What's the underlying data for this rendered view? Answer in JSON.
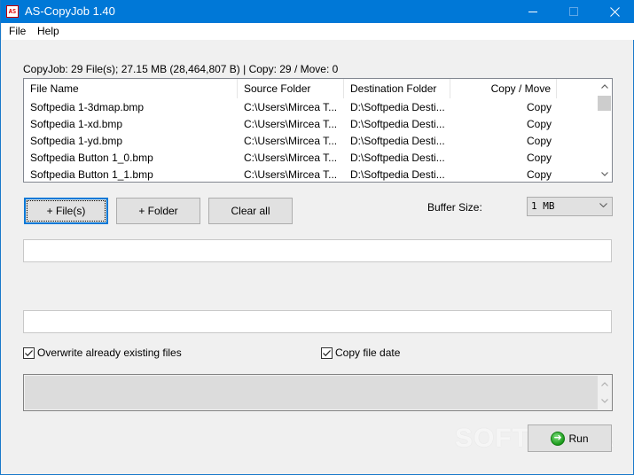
{
  "window": {
    "title": "AS-CopyJob 1.40",
    "icon_text": "AS",
    "controls": {
      "minimize": "minimize-icon",
      "maximize": "maximize-icon",
      "close": "close-icon"
    }
  },
  "menu": {
    "items": [
      {
        "label": "File"
      },
      {
        "label": "Help"
      }
    ]
  },
  "summary": "CopyJob: 29 File(s); 27.15 MB (28,464,807 B) | Copy: 29 / Move: 0",
  "file_list": {
    "columns": [
      "File Name",
      "Source Folder",
      "Destination Folder",
      "Copy / Move"
    ],
    "rows": [
      {
        "name": "Softpedia 1-3dmap.bmp",
        "source": "C:\\Users\\Mircea T...",
        "destination": "D:\\Softpedia Desti...",
        "mode": "Copy"
      },
      {
        "name": "Softpedia 1-xd.bmp",
        "source": "C:\\Users\\Mircea T...",
        "destination": "D:\\Softpedia Desti...",
        "mode": "Copy"
      },
      {
        "name": "Softpedia 1-yd.bmp",
        "source": "C:\\Users\\Mircea T...",
        "destination": "D:\\Softpedia Desti...",
        "mode": "Copy"
      },
      {
        "name": "Softpedia Button 1_0.bmp",
        "source": "C:\\Users\\Mircea T...",
        "destination": "D:\\Softpedia Desti...",
        "mode": "Copy"
      },
      {
        "name": "Softpedia Button 1_1.bmp",
        "source": "C:\\Users\\Mircea T...",
        "destination": "D:\\Softpedia Desti...",
        "mode": "Copy"
      }
    ]
  },
  "buttons": {
    "add_files": "+ File(s)",
    "add_folder": "+ Folder",
    "clear_all": "Clear all",
    "run": "Run"
  },
  "buffer": {
    "label": "Buffer Size:",
    "value": "1 MB"
  },
  "fields": {
    "field1_value": "",
    "field2_value": ""
  },
  "options": {
    "overwrite": {
      "label": "Overwrite already existing files",
      "checked": true
    },
    "copy_date": {
      "label": "Copy file date",
      "checked": true
    }
  },
  "log": {
    "value": ""
  },
  "watermark": "SOFTPEDIA",
  "colors": {
    "titlebar": "#0078d7",
    "focus": "#0078d7",
    "button_bg": "#e1e1e1",
    "window_bg": "#f0f0f0"
  }
}
